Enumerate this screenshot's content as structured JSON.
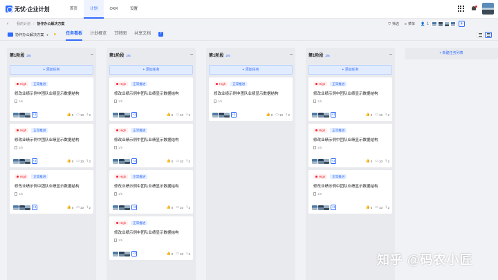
{
  "app": {
    "logo_text": "无忧·企业计划"
  },
  "nav": [
    "首页",
    "计划",
    "OKR",
    "设置"
  ],
  "breadcrumb": {
    "parent": "我的计划",
    "current": "协作办公解决方案"
  },
  "toolbar": {
    "filter": "筛选",
    "menu": "菜单",
    "member_count": "1"
  },
  "project": {
    "name": "协作办公解决方案"
  },
  "tabs": [
    "任务看板",
    "计划概览",
    "甘特图",
    "共享文档"
  ],
  "columns": [
    {
      "title": "第1阶段",
      "count": "2/6",
      "cards": 3
    },
    {
      "title": "第1阶段",
      "count": "2/6",
      "cards": 4
    },
    {
      "title": "第1阶段",
      "count": "2/6",
      "cards": 1
    },
    {
      "title": "第1阶段",
      "count": "2/6",
      "cards": 3
    }
  ],
  "add_task_label": "+ 添加任务",
  "card": {
    "priority": "High",
    "type": "正常推进",
    "title": "修改业绩示例中团队业绩显示数据结构",
    "subtask": "1/6",
    "more_members": "+3",
    "likes": "0",
    "comments": "10",
    "attachments": "2"
  },
  "new_list_label": "+ 新建任务列表",
  "watermark": "知乎 @码农小匠",
  "colors": {
    "accent": "#2f6bff",
    "high": "#f5222d",
    "star": "#faad14"
  }
}
